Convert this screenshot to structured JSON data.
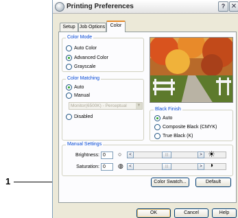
{
  "callout": {
    "number": "1"
  },
  "window": {
    "title": "Printing Preferences",
    "help_glyph": "?",
    "close_glyph": "✕"
  },
  "tabs": [
    {
      "label": "Setup"
    },
    {
      "label": "Job Options"
    },
    {
      "label": "Color"
    }
  ],
  "color_mode": {
    "title": "Color Mode",
    "options": [
      {
        "label": "Auto Color",
        "checked": false
      },
      {
        "label": "Advanced Color",
        "checked": true
      },
      {
        "label": "Grayscale",
        "checked": false
      }
    ]
  },
  "color_matching": {
    "title": "Color Matching",
    "options": [
      {
        "label": "Auto",
        "checked": true
      },
      {
        "label": "Manual",
        "checked": false
      },
      {
        "label": "Disabled",
        "checked": false
      }
    ],
    "select_value": "Monitor(6500K) - Perceptual"
  },
  "black_finish": {
    "title": "Black Finish",
    "options": [
      {
        "label": "Auto",
        "checked": true
      },
      {
        "label": "Composite Black (CMYK)",
        "checked": false
      },
      {
        "label": "True Black (K)",
        "checked": false
      }
    ]
  },
  "manual_settings": {
    "title": "Manual Settings",
    "brightness_label": "Brightness:",
    "brightness_value": "0",
    "saturation_label": "Saturation:",
    "saturation_value": "0",
    "left_arrow": "<",
    "right_arrow": ">",
    "thumb_glyph": "|||"
  },
  "buttons": {
    "color_swatch": "Color Swatch...",
    "default": "Default",
    "ok": "OK",
    "cancel": "Cancel",
    "help": "Help"
  },
  "colors": {
    "accent_blue": "#0046d5",
    "tab_highlight": "#e68b2c",
    "radio_dot": "#21a121"
  }
}
